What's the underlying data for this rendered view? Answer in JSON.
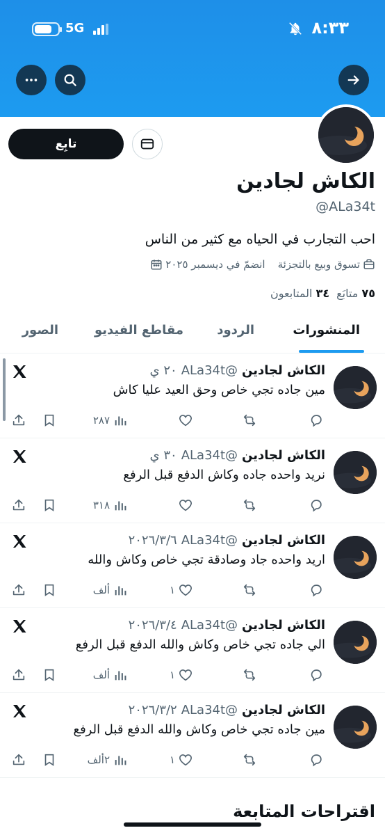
{
  "status_bar": {
    "time": "٨:٣٣",
    "network": "5G"
  },
  "header_buttons": {
    "back": "arrow-right-icon",
    "search": "search-icon",
    "more": "more-icon"
  },
  "profile": {
    "name": "الكاش لجادين",
    "handle": "@ALa34t",
    "bio": "احب التجارب في الحياه مع كثير من الناس",
    "category": "تسوق وبيع بالتجزئة",
    "joined": "انضمّ في ديسمبر ٢٠٢٥",
    "following_count": "٧٥",
    "following_label": "متابَع",
    "followers_count": "٣٤",
    "followers_label": "المتابعون",
    "follow_label": "تابِع"
  },
  "tabs": [
    "المنشورات",
    "الردود",
    "مقاطع الفيديو",
    "الصور"
  ],
  "posts": [
    {
      "name": "الكاش لجادين",
      "handle": "@ALa34t",
      "date": "٢٠ ي",
      "text": "مين جاده تجي خاص وحق العيد عليا كاش",
      "likes": "",
      "views": "٢٨٧"
    },
    {
      "name": "الكاش لجادين",
      "handle": "@ALa34t",
      "date": "٣٠ ي",
      "text": "نريد واحده جاده وكاش الدفع قبل الرفع",
      "likes": "",
      "views": "٣١٨"
    },
    {
      "name": "الكاش لجادين",
      "handle": "@ALa34t",
      "date": "٢٠٢٦/٣/٦",
      "text": "اريد واحده جاد وصادقة تجي خاص وكاش والله",
      "likes": "١",
      "views": "ألف"
    },
    {
      "name": "الكاش لجادين",
      "handle": "@ALa34t",
      "date": "٢٠٢٦/٣/٤",
      "text": "الي جاده تجي خاص وكاش والله الدفع قبل الرفع",
      "likes": "١",
      "views": "ألف"
    },
    {
      "name": "الكاش لجادين",
      "handle": "@ALa34t",
      "date": "٢٠٢٦/٣/٢",
      "text": "مين جاده تجي خاص وكاش والله الدفع قبل الرفع",
      "likes": "١",
      "views": "٢ألف"
    }
  ],
  "suggestions_title": "اقتراحات المتابعة",
  "colors": {
    "accent": "#1d9bf0",
    "banner": "#1d9bf0",
    "text": "#0f1419",
    "muted": "#536471"
  }
}
